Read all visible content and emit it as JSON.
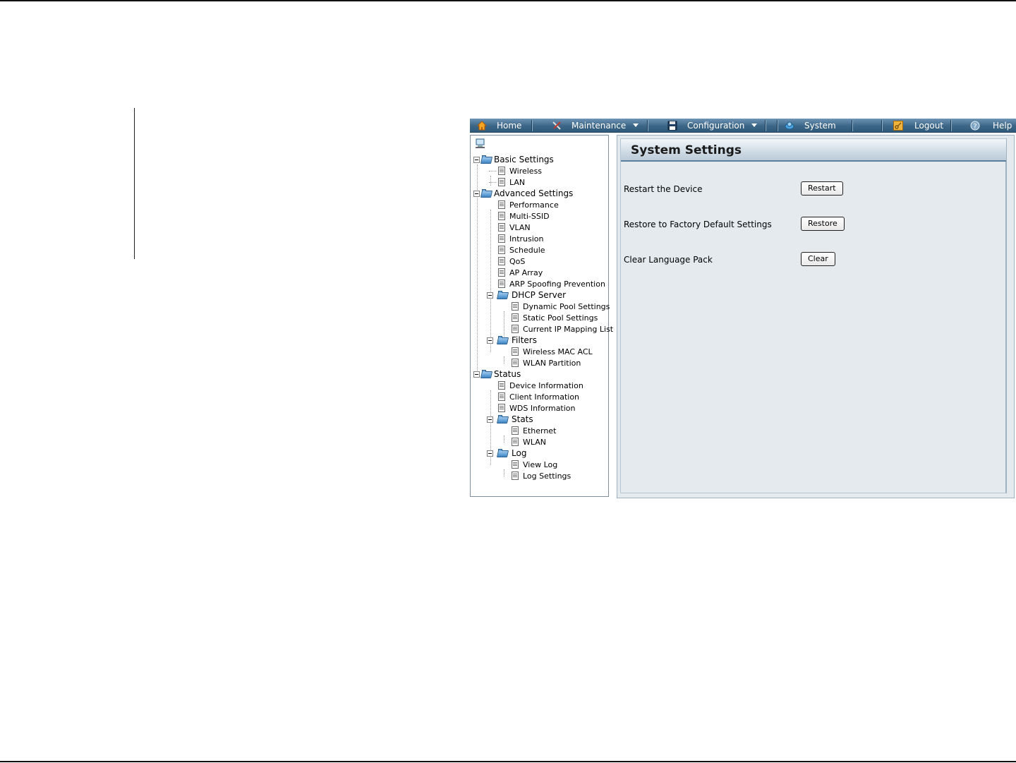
{
  "nav": {
    "home": "Home",
    "maintenance": "Maintenance",
    "configuration": "Configuration",
    "system": "System",
    "logout": "Logout",
    "help": "Help"
  },
  "tree": {
    "basic": "Basic Settings",
    "wireless": "Wireless",
    "lan": "LAN",
    "advanced": "Advanced Settings",
    "performance": "Performance",
    "multi_ssid": "Multi-SSID",
    "vlan": "VLAN",
    "intrusion": "Intrusion",
    "schedule": "Schedule",
    "qos": "QoS",
    "ap_array": "AP Array",
    "arp": "ARP Spoofing Prevention",
    "dhcp": "DHCP Server",
    "dynamic_pool": "Dynamic Pool Settings",
    "static_pool": "Static Pool Settings",
    "ip_mapping": "Current IP Mapping List",
    "filters": "Filters",
    "wireless_mac_acl": "Wireless MAC ACL",
    "wlan_partition": "WLAN Partition",
    "status": "Status",
    "device_info": "Device Information",
    "client_info": "Client Information",
    "wds_info": "WDS Information",
    "stats": "Stats",
    "ethernet": "Ethernet",
    "wlan": "WLAN",
    "log": "Log",
    "view_log": "View Log",
    "log_settings": "Log Settings"
  },
  "main": {
    "title": "System Settings",
    "restart_label": "Restart the Device",
    "restart_button": "Restart",
    "restore_label": "Restore to Factory Default Settings",
    "restore_button": "Restore",
    "clear_label": "Clear Language Pack",
    "clear_button": "Clear"
  },
  "colors": {
    "nav_bar": "#3d6686",
    "panel_bg": "#e4eaee",
    "title_underline": "#5a7f9e"
  }
}
